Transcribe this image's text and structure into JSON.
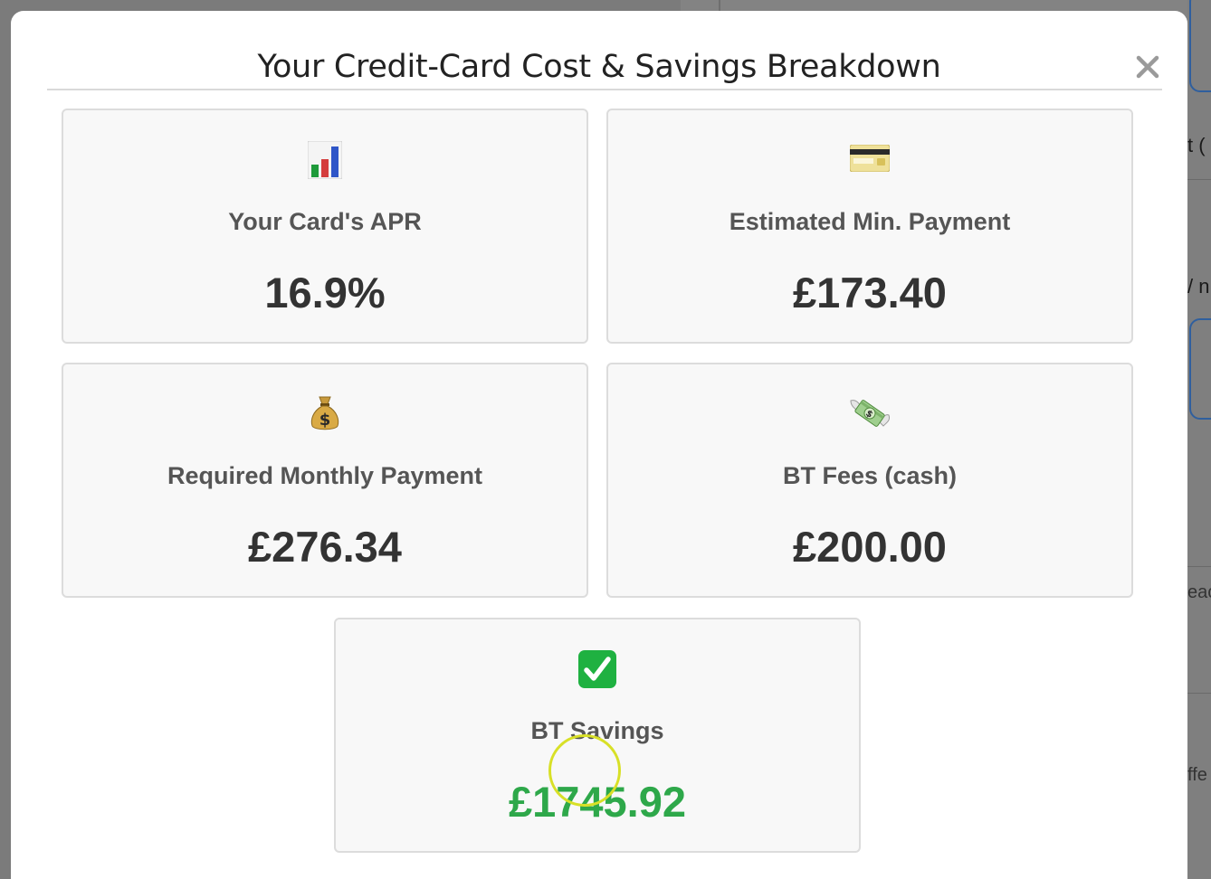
{
  "modal": {
    "title": "Your Credit-Card Cost & Savings Breakdown",
    "close_symbol": "×"
  },
  "cards": [
    {
      "icon": "bar-chart-icon",
      "label": "Your Card's APR",
      "value": "16.9%"
    },
    {
      "icon": "credit-card-icon",
      "label": "Estimated Min. Payment",
      "value": "£173.40"
    },
    {
      "icon": "money-bag-icon",
      "label": "Required Monthly Payment",
      "value": "£276.34"
    },
    {
      "icon": "money-with-wings-icon",
      "label": "BT Fees (cash)",
      "value": "£200.00"
    },
    {
      "icon": "check-mark-button-icon",
      "label": "BT Savings",
      "value": "£1745.92",
      "value_color": "#2ea84a"
    }
  ],
  "background": {
    "fragments": [
      "t (",
      "/ n",
      "eac",
      "ffe"
    ]
  }
}
